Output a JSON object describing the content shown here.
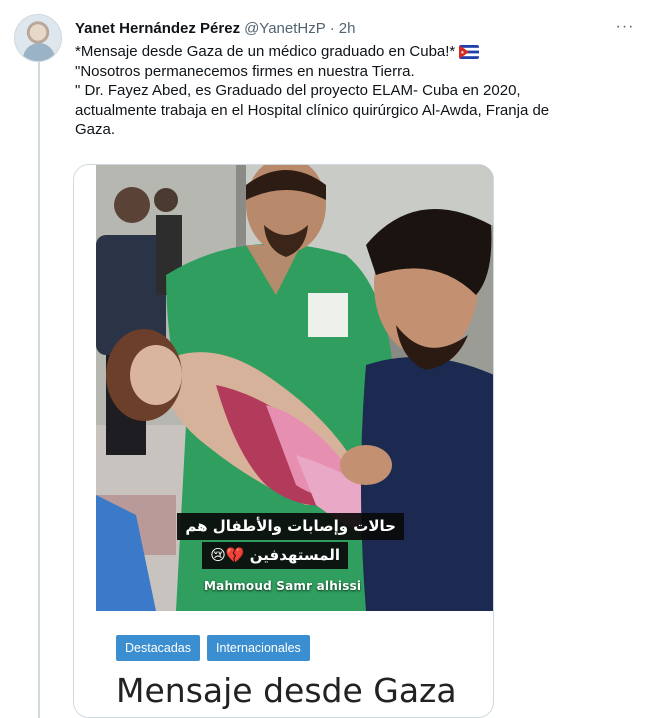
{
  "tweet": {
    "display_name": "Yanet Hernández Pérez",
    "handle": "@YanetHzP",
    "separator": "·",
    "time": "2h",
    "more_label": "···",
    "lines": [
      "*Mensaje desde Gaza de un médico graduado en Cuba!*",
      "\"Nosotros permanecemos firmes en nuestra Tierra.",
      "\" Dr. Fayez Abed, es Graduado del proyecto ELAM- Cuba en 2020,",
      "actualmente trabaja en el Hospital clínico quirúrgico Al-Awda, Franja de",
      "Gaza."
    ],
    "flag_icon": "cuba-flag-icon"
  },
  "card": {
    "caption_line1": "حالات وإصابات والأطفال هم",
    "caption_line2": "المستهدفين 💔😢",
    "watermark": "Mahmoud Samr alhissi",
    "tags": [
      "Destacadas",
      "Internacionales"
    ],
    "title": "Mensaje desde Gaza"
  },
  "colors": {
    "tag_bg": "#3b8fd0",
    "scrubs": "#2f9e5e",
    "thread_line": "#cfd9de"
  }
}
